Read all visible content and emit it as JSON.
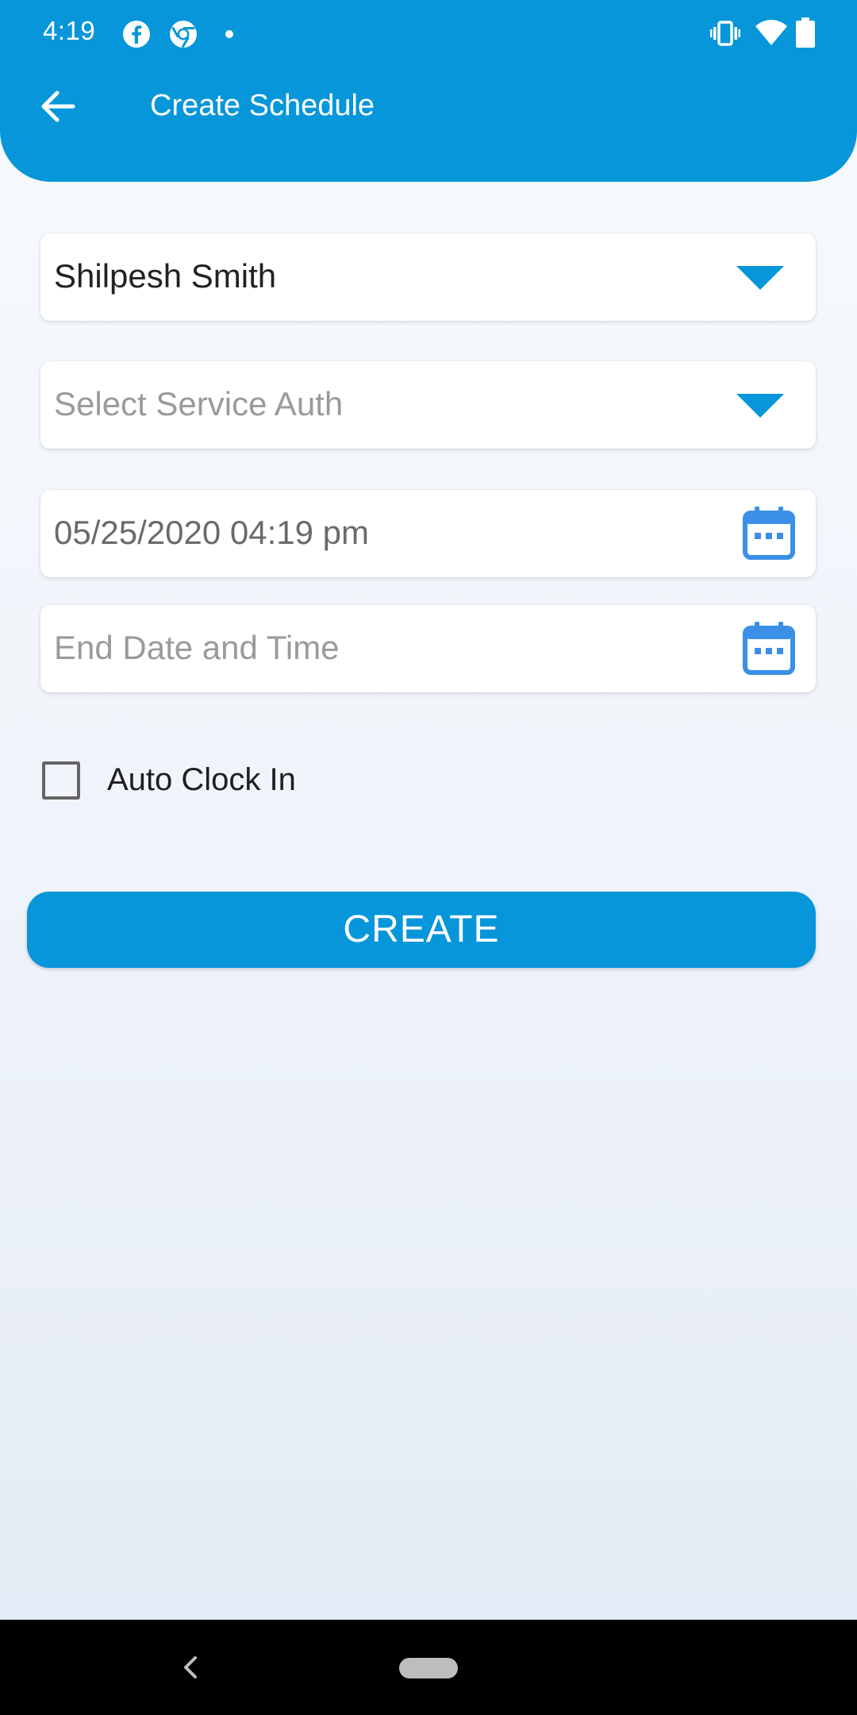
{
  "status_bar": {
    "time": "4:19",
    "left_icons": [
      "facebook-icon",
      "chrome-icon",
      "dot-icon"
    ],
    "right_icons": [
      "vibrate-icon",
      "wifi-icon",
      "battery-icon"
    ]
  },
  "toolbar": {
    "back_icon": "arrow-left-icon",
    "title": "Create Schedule"
  },
  "form": {
    "client_select": {
      "value": "Shilpesh Smith",
      "icon": "dropdown-arrow-icon"
    },
    "service_auth_select": {
      "placeholder": "Select Service Auth",
      "icon": "dropdown-arrow-icon"
    },
    "start_datetime": {
      "value": "05/25/2020 04:19 pm",
      "icon": "calendar-icon"
    },
    "end_datetime": {
      "placeholder": "End Date and Time",
      "icon": "calendar-icon"
    },
    "auto_clock_in": {
      "label": "Auto Clock In",
      "checked": false
    },
    "create_button_label": "CREATE"
  },
  "colors": {
    "primary": "#0796d9",
    "calendar_blue": "#3b8fe6",
    "placeholder_text": "#9a9a9a",
    "nav_bar": "#000000"
  },
  "nav_bar": {
    "icons": [
      "nav-back-icon",
      "nav-home-pill"
    ]
  }
}
